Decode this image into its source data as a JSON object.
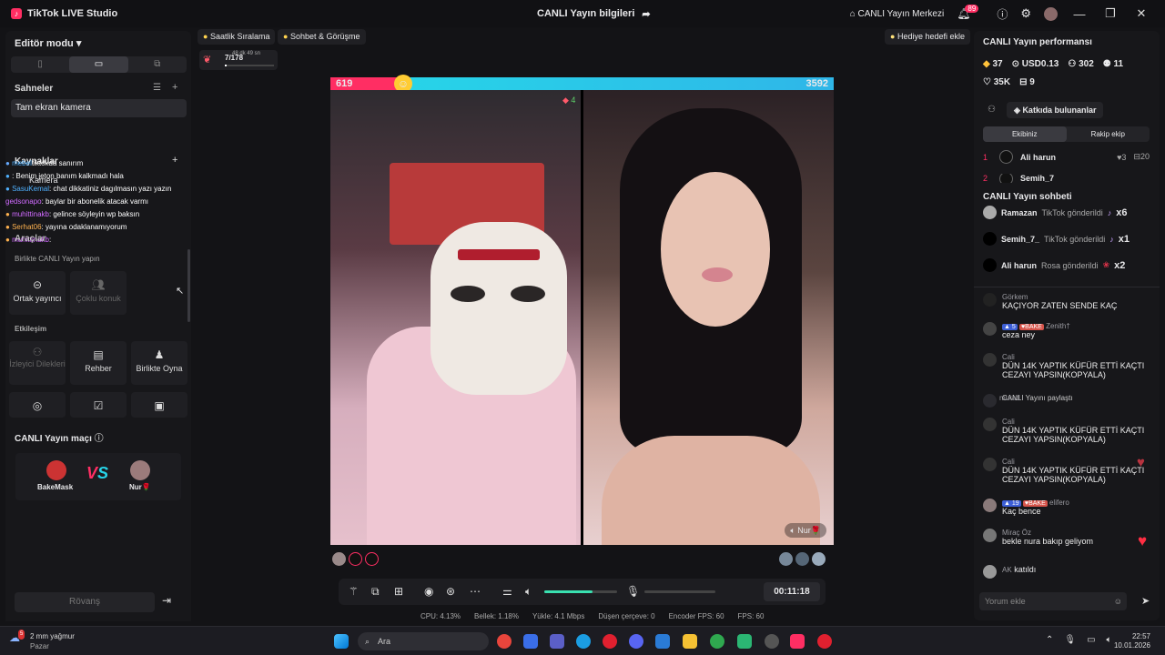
{
  "titlebar": {
    "app_name": "TikTok LIVE Studio",
    "center_title": "CANLI Yayın bilgileri",
    "live_center": "CANLI Yayın Merkezi",
    "notif_count": "89"
  },
  "left": {
    "editor_mode": "Editör modu",
    "scenes_title": "Sahneler",
    "scene_item": "Tam ekran kamera",
    "sources_title": "Kaynaklar",
    "source_item": "Kamera",
    "tools_title": "Araçlar",
    "cohost_title": "Birlikte CANLI Yayın yapın",
    "chat_overlay": [
      {
        "user": "tiktokda sanırım",
        "color": "#ffd34f",
        "msg": ""
      },
      {
        "user": "",
        "color": "#4fb1ff",
        "msg": ": Benim jeton banım kalkmadı hala"
      },
      {
        "user": "SasuKemal",
        "color": "#4fb1ff",
        "msg": ": chat dikkatiniz dagılmasın yazı yazın"
      },
      {
        "user": "gedsonapo",
        "color": "#d06bff",
        "msg": ": baylar bir abonelik atacak varmı"
      },
      {
        "user": "muhittinakb",
        "color": "#d06bff",
        "msg": ": gelince söyleyin wp baksın"
      },
      {
        "user": "Serhat06",
        "color": "#ffb24f",
        "msg": ": yayına odaklanamıyorum"
      },
      {
        "user": "muhittinakb",
        "color": "#d06bff",
        "msg": ":"
      }
    ],
    "tiles": {
      "cohost": "Ortak yayıncı",
      "multi_guest": "Çoklu konuk",
      "interaction_title": "Etkileşim",
      "viewer_wishes": "İzleyici Dilekleri",
      "guide": "Rehber",
      "play_together": "Birlikte Oyna"
    },
    "match": {
      "title": "CANLI Yayın maçı",
      "player1": "BakeMask",
      "player2": "Nur🌹",
      "vs": "VS",
      "rematch": "Rövanş"
    }
  },
  "center": {
    "pill_hourly": "Saatlik Sıralama",
    "pill_chat": "Sohbet & Görüşme",
    "pill_gift_goal": "Hediye hedefi ekle",
    "goal_progress": "7/178",
    "goal_timer": "48 dk 49 sn",
    "score_left": "619",
    "score_right": "3592",
    "streak": "4",
    "right_cam_label": "Nur🌹",
    "timer": "00:11:18",
    "volume_fraction": 0.66
  },
  "stats": {
    "cpu": "CPU:  4.13%",
    "memory": "Bellek:  1.18%",
    "upload": "Yükle:  4.1 Mbps",
    "dropped": "Düşen çerçeve:  0",
    "encoder_fps": "Encoder FPS:  60",
    "fps": "FPS:  60"
  },
  "right": {
    "perf_title": "CANLI Yayın performansı",
    "diamonds": "37",
    "usd": "USD0.13",
    "viewers": "302",
    "new_followers": "11",
    "likes": "35K",
    "gifters": "9",
    "contributors_btn": "Katkıda bulunanlar",
    "tab_yours": "Ekibiniz",
    "tab_rival": "Rakip ekip",
    "rank1": {
      "pos": "1",
      "name": "Ali harun",
      "count": "3",
      "score": "20"
    },
    "rank2": {
      "pos": "2",
      "name": "Semih_7"
    },
    "chat_title": "CANLI Yayın sohbeti",
    "gifts": [
      {
        "name": "Ramazan",
        "action": "TikTok gönderildi",
        "mult": "x6"
      },
      {
        "name": "Semih_7_",
        "action": "TikTok gönderildi",
        "mult": "x1"
      },
      {
        "name": "Ali harun",
        "action": "Rosa gönderildi",
        "mult": "x2"
      }
    ],
    "messages": [
      {
        "name": "Görkem",
        "text": "KAÇIYOR ZATEN SENDE KAÇ"
      },
      {
        "name": "Zenith†",
        "text": "ceza ney",
        "level": "5",
        "team": "BAKE"
      },
      {
        "name": "Cali",
        "text": "DÜN 14K YAPTIK KÜFÜR ETTİ KAÇTI CEZAYI YAPSIN(KOPYALA)"
      },
      {
        "name": "murad",
        "text": "CANLI Yayını paylaştı"
      },
      {
        "name": "Cali",
        "text": "DÜN 14K YAPTIK KÜFÜR ETTİ KAÇTI CEZAYI YAPSIN(KOPYALA)"
      },
      {
        "name": "Cali",
        "text": "DÜN 14K YAPTIK KÜFÜR ETTİ KAÇTI CEZAYI YAPSIN(KOPYALA)"
      },
      {
        "name": "elifero",
        "text": "Kaç bence",
        "level": "19",
        "team": "BAKE"
      },
      {
        "name": "Miraç Öz",
        "text": "bekle nura bakıp geliyom"
      },
      {
        "name": "AK",
        "text": "katıldı"
      }
    ],
    "comment_placeholder": "Yorum ekle"
  },
  "taskbar": {
    "weather": "2 mm yağmur",
    "weather_day": "Pazar",
    "weather_badge": "5",
    "search": "Ara",
    "time": "22:57",
    "date": "10.01.2026"
  }
}
